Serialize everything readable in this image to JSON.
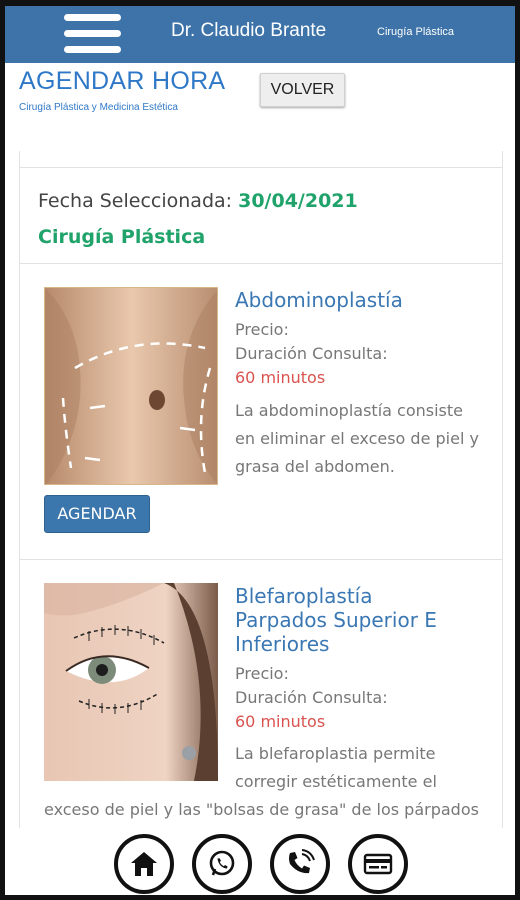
{
  "header": {
    "app_title": "Dr. Claudio Brante",
    "app_subtitle": "Cirugía Plástica",
    "menu_icon": "hamburger-menu-icon"
  },
  "page": {
    "title": "AGENDAR HORA",
    "subtitle": "Cirugía Plástica y Medicina Estética",
    "back_label": "VOLVER"
  },
  "selection": {
    "date_label": "Fecha Seleccionada:",
    "date_value": "30/04/2021",
    "category": "Cirugía Plástica"
  },
  "procedures": [
    {
      "title": "Abdominoplastía",
      "price_label": "Precio:",
      "duration_label": "Duración Consulta:",
      "duration_value": "60 minutos",
      "description_lines": [
        "La abdominoplastía consiste",
        "en eliminar el exceso de piel y",
        "grasa del abdomen."
      ],
      "button_label": "AGENDAR"
    },
    {
      "title_lines": [
        "Blefaroplastía",
        "Parpados Superior E",
        "Inferiores"
      ],
      "price_label": "Precio:",
      "duration_label": "Duración Consulta:",
      "duration_value": "60 minutos",
      "description_lines": [
        "La blefaroplastia permite",
        "corregir estéticamente el",
        "exceso de piel y las \"bolsas de grasa\" de los párpados"
      ]
    }
  ],
  "bottom_nav": [
    {
      "icon": "home-icon"
    },
    {
      "icon": "whatsapp-icon"
    },
    {
      "icon": "phone-icon"
    },
    {
      "icon": "payment-card-icon"
    }
  ],
  "colors": {
    "header_bg": "#3d73a8",
    "title_blue": "#2f78c7",
    "green": "#1fa36a",
    "red": "#d9534f",
    "button_blue": "#3b76ad"
  }
}
